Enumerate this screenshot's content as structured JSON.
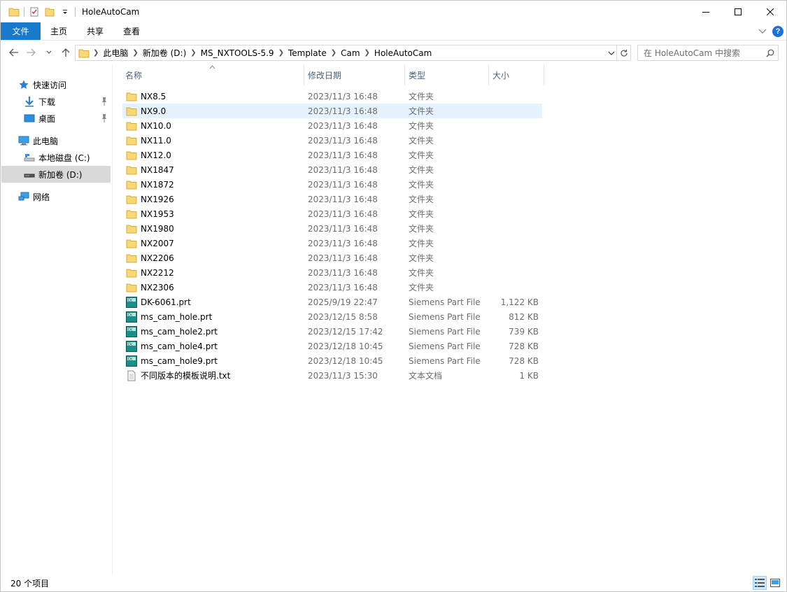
{
  "window": {
    "title": "HoleAutoCam"
  },
  "ribbon": {
    "tabs": [
      "文件",
      "主页",
      "共享",
      "查看"
    ],
    "help": "?"
  },
  "address": {
    "crumbs": [
      "此电脑",
      "新加卷 (D:)",
      "MS_NXTOOLS-5.9",
      "Template",
      "Cam",
      "HoleAutoCam"
    ]
  },
  "search": {
    "placeholder": "在 HoleAutoCam 中搜索"
  },
  "nav": {
    "quick_access": "快速访问",
    "downloads": "下载",
    "desktop": "桌面",
    "this_pc": "此电脑",
    "local_disk": "本地磁盘 (C:)",
    "new_volume": "新加卷 (D:)",
    "network": "网络"
  },
  "columns": {
    "name": "名称",
    "date": "修改日期",
    "type": "类型",
    "size": "大小"
  },
  "files": [
    {
      "name": "NX8.5",
      "date": "2023/11/3 16:48",
      "type": "文件夹",
      "size": "",
      "kind": "folder"
    },
    {
      "name": "NX9.0",
      "date": "2023/11/3 16:48",
      "type": "文件夹",
      "size": "",
      "kind": "folder"
    },
    {
      "name": "NX10.0",
      "date": "2023/11/3 16:48",
      "type": "文件夹",
      "size": "",
      "kind": "folder"
    },
    {
      "name": "NX11.0",
      "date": "2023/11/3 16:48",
      "type": "文件夹",
      "size": "",
      "kind": "folder"
    },
    {
      "name": "NX12.0",
      "date": "2023/11/3 16:48",
      "type": "文件夹",
      "size": "",
      "kind": "folder"
    },
    {
      "name": "NX1847",
      "date": "2023/11/3 16:48",
      "type": "文件夹",
      "size": "",
      "kind": "folder"
    },
    {
      "name": "NX1872",
      "date": "2023/11/3 16:48",
      "type": "文件夹",
      "size": "",
      "kind": "folder"
    },
    {
      "name": "NX1926",
      "date": "2023/11/3 16:48",
      "type": "文件夹",
      "size": "",
      "kind": "folder"
    },
    {
      "name": "NX1953",
      "date": "2023/11/3 16:48",
      "type": "文件夹",
      "size": "",
      "kind": "folder"
    },
    {
      "name": "NX1980",
      "date": "2023/11/3 16:48",
      "type": "文件夹",
      "size": "",
      "kind": "folder"
    },
    {
      "name": "NX2007",
      "date": "2023/11/3 16:48",
      "type": "文件夹",
      "size": "",
      "kind": "folder"
    },
    {
      "name": "NX2206",
      "date": "2023/11/3 16:48",
      "type": "文件夹",
      "size": "",
      "kind": "folder"
    },
    {
      "name": "NX2212",
      "date": "2023/11/3 16:48",
      "type": "文件夹",
      "size": "",
      "kind": "folder"
    },
    {
      "name": "NX2306",
      "date": "2023/11/3 16:48",
      "type": "文件夹",
      "size": "",
      "kind": "folder"
    },
    {
      "name": "DK-6061.prt",
      "date": "2025/9/19 22:47",
      "type": "Siemens Part File",
      "size": "1,122 KB",
      "kind": "prt"
    },
    {
      "name": "ms_cam_hole.prt",
      "date": "2023/12/15 8:58",
      "type": "Siemens Part File",
      "size": "812 KB",
      "kind": "prt"
    },
    {
      "name": "ms_cam_hole2.prt",
      "date": "2023/12/15 17:42",
      "type": "Siemens Part File",
      "size": "739 KB",
      "kind": "prt"
    },
    {
      "name": "ms_cam_hole4.prt",
      "date": "2023/12/18 10:45",
      "type": "Siemens Part File",
      "size": "728 KB",
      "kind": "prt"
    },
    {
      "name": "ms_cam_hole9.prt",
      "date": "2023/12/18 10:45",
      "type": "Siemens Part File",
      "size": "728 KB",
      "kind": "prt"
    },
    {
      "name": "不同版本的模板说明.txt",
      "date": "2023/11/3 15:30",
      "type": "文本文档",
      "size": "1 KB",
      "kind": "txt"
    }
  ],
  "hovered_file": "NX9.0",
  "status": {
    "count": "20 个项目"
  },
  "colors": {
    "accent": "#1979ca",
    "hover_row": "#e5f3ff",
    "nav_selected": "#d9d9d9",
    "folder": "#f8d775"
  }
}
